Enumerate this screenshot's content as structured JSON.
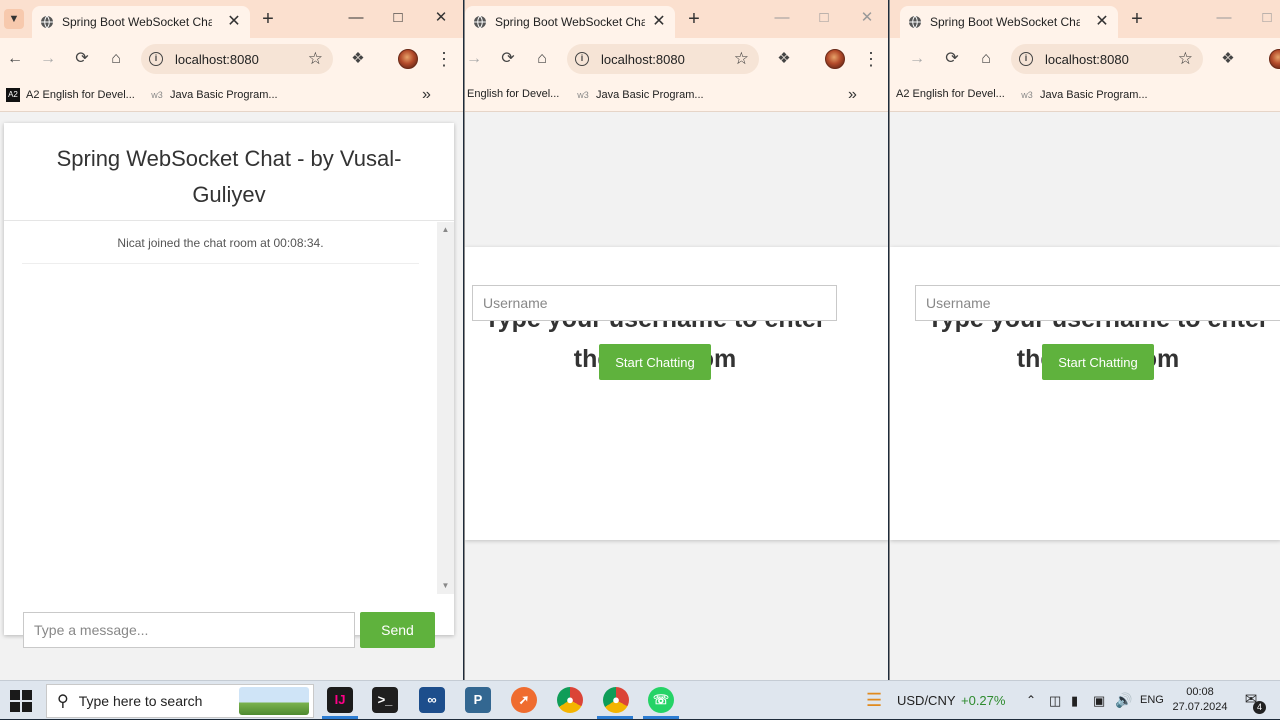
{
  "browser": {
    "tab_title": "Spring Boot WebSocket Chat Ap",
    "url": "localhost:8080",
    "bookmarks": [
      "A2 English for Devel...",
      "Java Basic Program..."
    ],
    "bookmarks_partial": "English for Devel...",
    "bookmark_icon_a2": "A2",
    "bookmark_icon_w3": "w3"
  },
  "chat": {
    "header": "Spring WebSocket Chat - by Vusal-Guliyev",
    "events": [
      "Nicat joined the chat room at 00:08:34."
    ],
    "message_placeholder": "Type a message...",
    "send_label": "Send"
  },
  "entry": {
    "title": "Type your username to enter the Chatroom",
    "username_placeholder": "Username",
    "start_label": "Start Chatting"
  },
  "taskbar": {
    "search_placeholder": "Type here to search",
    "currency_pair": "USD/CNY",
    "currency_change": "+0.27%",
    "language": "ENG",
    "time": "00:08",
    "date": "27.07.2024",
    "notification_count": "4",
    "apps": [
      "intellij-icon",
      "terminal-icon",
      "vscode-icon",
      "postgres-icon",
      "postman-icon",
      "chrome-icon",
      "chrome-profile-icon",
      "whatsapp-icon"
    ]
  },
  "colors": {
    "accent_green": "#5fb23d",
    "tabbar": "#fbe0cf",
    "currency_up": "#2e8b2e"
  }
}
